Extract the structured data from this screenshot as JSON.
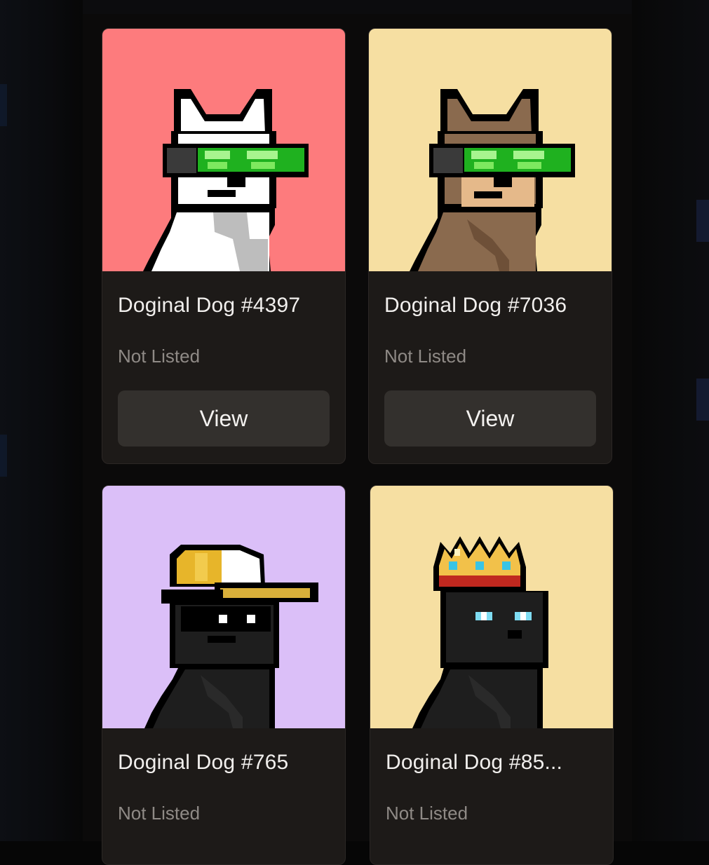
{
  "cards": [
    {
      "name": "Doginal Dog #4397",
      "status": "Not Listed",
      "action": "View",
      "bg": "#fd7b7d",
      "subject": "white dog with green visor"
    },
    {
      "name": "Doginal Dog #7036",
      "status": "Not Listed",
      "action": "View",
      "bg": "#f6dfa2",
      "subject": "brown dog with green visor"
    },
    {
      "name": "Doginal Dog #765",
      "status": "Not Listed",
      "bg": "#dbbff8",
      "subject": "black dog with yellow cap and sunglasses"
    },
    {
      "name": "Doginal Dog #85...",
      "status": "Not Listed",
      "bg": "#f6dfa2",
      "subject": "black dog with gold crown"
    }
  ]
}
